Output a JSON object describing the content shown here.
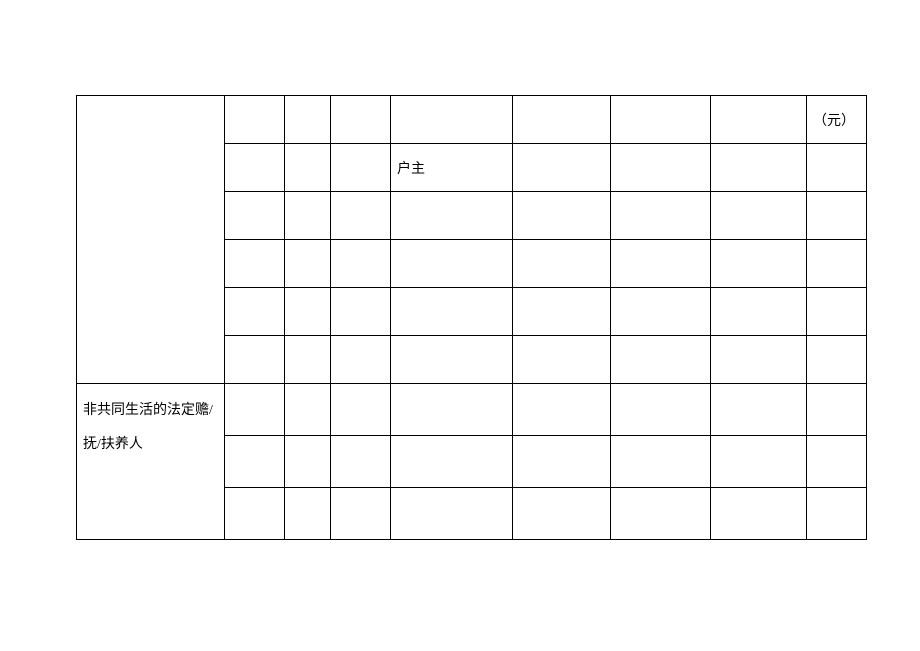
{
  "table": {
    "section1_label": "",
    "section2_label": "非共同生活的法定赡/抚/扶养人",
    "header": {
      "unit": "（元）"
    },
    "rows": [
      {
        "c2": "",
        "c3": "",
        "c4": "",
        "c5": "户主",
        "c6": "",
        "c7": "",
        "c8": "",
        "c9": ""
      },
      {
        "c2": "",
        "c3": "",
        "c4": "",
        "c5": "",
        "c6": "",
        "c7": "",
        "c8": "",
        "c9": ""
      },
      {
        "c2": "",
        "c3": "",
        "c4": "",
        "c5": "",
        "c6": "",
        "c7": "",
        "c8": "",
        "c9": ""
      },
      {
        "c2": "",
        "c3": "",
        "c4": "",
        "c5": "",
        "c6": "",
        "c7": "",
        "c8": "",
        "c9": ""
      },
      {
        "c2": "",
        "c3": "",
        "c4": "",
        "c5": "",
        "c6": "",
        "c7": "",
        "c8": "",
        "c9": ""
      },
      {
        "c2": "",
        "c3": "",
        "c4": "",
        "c5": "",
        "c6": "",
        "c7": "",
        "c8": "",
        "c9": ""
      },
      {
        "c2": "",
        "c3": "",
        "c4": "",
        "c5": "",
        "c6": "",
        "c7": "",
        "c8": "",
        "c9": ""
      },
      {
        "c2": "",
        "c3": "",
        "c4": "",
        "c5": "",
        "c6": "",
        "c7": "",
        "c8": "",
        "c9": ""
      }
    ]
  }
}
